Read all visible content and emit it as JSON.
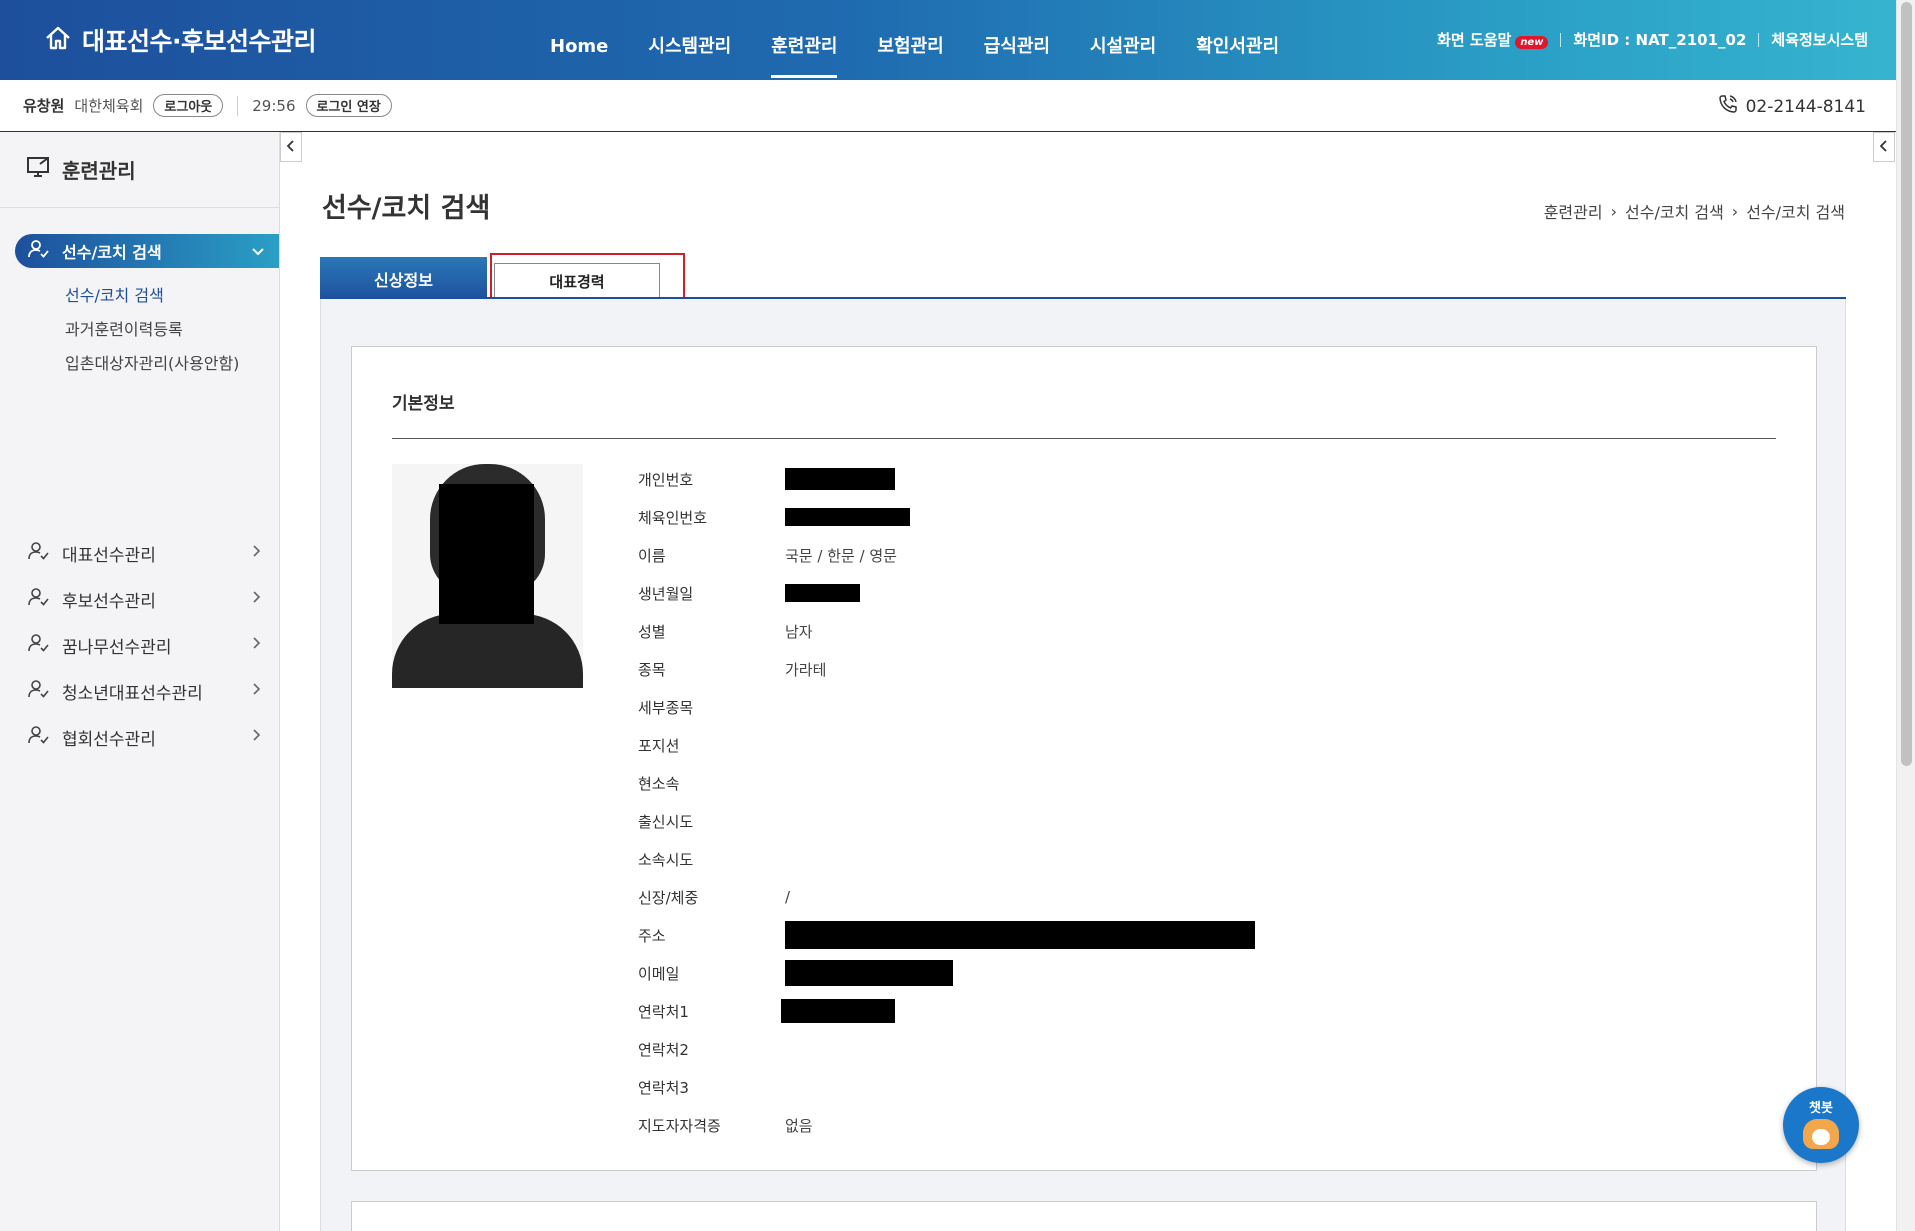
{
  "header": {
    "title": "대표선수·후보선수관리",
    "nav": [
      "Home",
      "시스템관리",
      "훈련관리",
      "보험관리",
      "급식관리",
      "시설관리",
      "확인서관리"
    ],
    "active_nav": "훈련관리",
    "help_label": "화면 도움말",
    "new_badge": "new",
    "screen_id": "화면ID : NAT_2101_02",
    "system_link": "체육정보시스템"
  },
  "session": {
    "user_name": "유창원",
    "org": "대한체육회",
    "logout_label": "로그아웃",
    "timer": "29:56",
    "extend_label": "로그인 연장",
    "phone": "02-2144-8141"
  },
  "sidebar": {
    "title": "훈련관리",
    "active_menu": "선수/코치 검색",
    "sub_items": [
      "선수/코치 검색",
      "과거훈련이력등록",
      "입촌대상자관리(사용안함)"
    ],
    "menus": [
      "대표선수관리",
      "후보선수관리",
      "꿈나무선수관리",
      "청소년대표선수관리",
      "협회선수관리"
    ]
  },
  "page": {
    "title": "선수/코치 검색",
    "breadcrumb": [
      "훈련관리",
      "선수/코치 검색",
      "선수/코치 검색"
    ],
    "tabs": [
      "신상정보",
      "대표경력"
    ]
  },
  "profile": {
    "section_title": "기본정보",
    "fields": [
      {
        "label": "개인번호",
        "value": ""
      },
      {
        "label": "체육인번호",
        "value": ""
      },
      {
        "label": "이름",
        "value": "국문 / 한문 / 영문"
      },
      {
        "label": "생년월일",
        "value": ""
      },
      {
        "label": "성별",
        "value": "남자"
      },
      {
        "label": "종목",
        "value": "가라테"
      },
      {
        "label": "세부종목",
        "value": ""
      },
      {
        "label": "포지션",
        "value": ""
      },
      {
        "label": "현소속",
        "value": ""
      },
      {
        "label": "출신시도",
        "value": ""
      },
      {
        "label": "소속시도",
        "value": ""
      },
      {
        "label": "신장/체중",
        "value": "/"
      },
      {
        "label": "주소",
        "value": ""
      },
      {
        "label": "이메일",
        "value": ""
      },
      {
        "label": "연락처1",
        "value": ""
      },
      {
        "label": "연락처2",
        "value": ""
      },
      {
        "label": "연락처3",
        "value": ""
      },
      {
        "label": "지도자자격증",
        "value": "없음"
      }
    ]
  },
  "chatbot": {
    "label": "챗봇"
  }
}
